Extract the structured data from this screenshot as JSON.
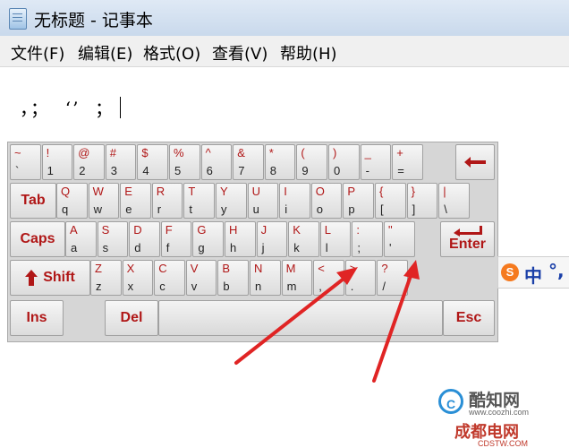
{
  "window": {
    "title": "无标题 - 记事本"
  },
  "menu": [
    {
      "id": "file",
      "label": "文件(F)"
    },
    {
      "id": "edit",
      "label": "编辑(E)"
    },
    {
      "id": "format",
      "label": "格式(O)"
    },
    {
      "id": "view",
      "label": "查看(V)"
    },
    {
      "id": "help",
      "label": "帮助(H)"
    }
  ],
  "document": {
    "text": "，；  ‘’  ；"
  },
  "keyboard": {
    "rows": [
      [
        {
          "shift": "~",
          "base": "`"
        },
        {
          "shift": "!",
          "base": "1"
        },
        {
          "shift": "@",
          "base": "2"
        },
        {
          "shift": "#",
          "base": "3"
        },
        {
          "shift": "$",
          "base": "4"
        },
        {
          "shift": "%",
          "base": "5"
        },
        {
          "shift": "^",
          "base": "6"
        },
        {
          "shift": "&",
          "base": "7"
        },
        {
          "shift": "*",
          "base": "8"
        },
        {
          "shift": "(",
          "base": "9"
        },
        {
          "shift": ")",
          "base": "0"
        },
        {
          "shift": "_",
          "base": "-"
        },
        {
          "shift": "+",
          "base": "="
        }
      ],
      [
        {
          "shift": "Q",
          "base": "q"
        },
        {
          "shift": "W",
          "base": "w"
        },
        {
          "shift": "E",
          "base": "e"
        },
        {
          "shift": "R",
          "base": "r"
        },
        {
          "shift": "T",
          "base": "t"
        },
        {
          "shift": "Y",
          "base": "y"
        },
        {
          "shift": "U",
          "base": "u"
        },
        {
          "shift": "I",
          "base": "i"
        },
        {
          "shift": "O",
          "base": "o"
        },
        {
          "shift": "P",
          "base": "p"
        },
        {
          "shift": "{",
          "base": "["
        },
        {
          "shift": "}",
          "base": "]"
        },
        {
          "shift": "|",
          "base": "\\"
        }
      ],
      [
        {
          "shift": "A",
          "base": "a"
        },
        {
          "shift": "S",
          "base": "s"
        },
        {
          "shift": "D",
          "base": "d"
        },
        {
          "shift": "F",
          "base": "f"
        },
        {
          "shift": "G",
          "base": "g"
        },
        {
          "shift": "H",
          "base": "h"
        },
        {
          "shift": "J",
          "base": "j"
        },
        {
          "shift": "K",
          "base": "k"
        },
        {
          "shift": "L",
          "base": "l"
        },
        {
          "shift": ":",
          "base": ";"
        },
        {
          "shift": "\"",
          "base": "'"
        }
      ],
      [
        {
          "shift": "Z",
          "base": "z"
        },
        {
          "shift": "X",
          "base": "x"
        },
        {
          "shift": "C",
          "base": "c"
        },
        {
          "shift": "V",
          "base": "v"
        },
        {
          "shift": "B",
          "base": "b"
        },
        {
          "shift": "N",
          "base": "n"
        },
        {
          "shift": "M",
          "base": "m"
        },
        {
          "shift": "<",
          "base": ","
        },
        {
          "shift": ">",
          "base": "."
        },
        {
          "shift": "?",
          "base": "/"
        }
      ]
    ],
    "tab": "Tab",
    "caps": "Caps",
    "enter": "Enter",
    "shift": "Shift",
    "ins": "Ins",
    "del": "Del",
    "esc": "Esc"
  },
  "ime": {
    "logo": "S",
    "mode": "中",
    "punct": "°,"
  },
  "watermarks": {
    "site1_logo": "C",
    "site1_name": "酷知网",
    "site1_url": "www.coozhi.com",
    "site2_name": "成都电网",
    "site2_url": "CDSTW.COM"
  },
  "colors": {
    "key_legend_shift": "#b01717",
    "arrow": "#e02424"
  }
}
